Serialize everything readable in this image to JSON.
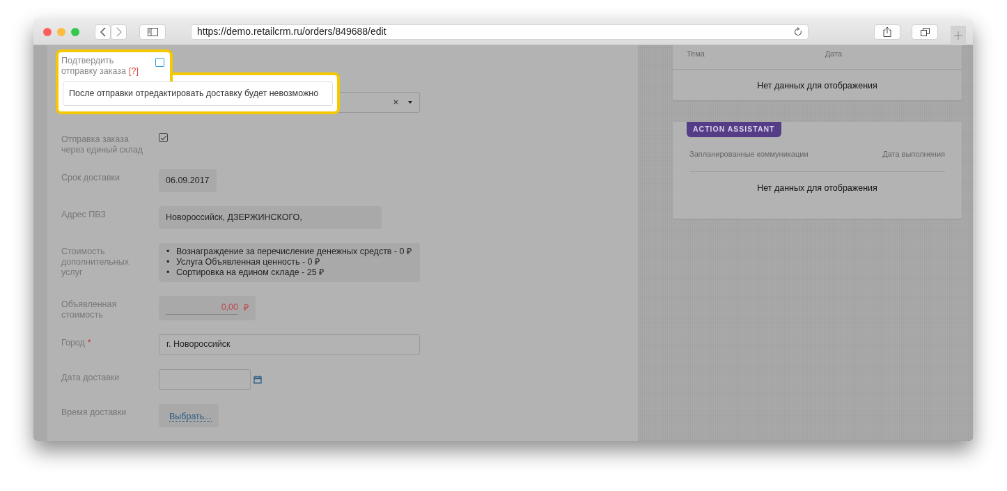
{
  "browser": {
    "url": "https://demo.retailcrm.ru/orders/849688/edit"
  },
  "spotlight": {
    "label": "Подтвердить отправку заказа",
    "help": "[?]",
    "checked": false,
    "tooltip": "После отправки отредактировать доставку будет невозможно"
  },
  "form": [
    {
      "kind": "select",
      "clear": "×"
    },
    {
      "kind": "checkbox",
      "label": "Отправка заказа через единый склад",
      "checked": true
    },
    {
      "kind": "static",
      "label": "Срок доставки",
      "value": "06.09.2017"
    },
    {
      "kind": "static",
      "label": "Адрес ПВЗ",
      "value": "Новороссийск, ДЗЕРЖИНСКОГО,",
      "wide": true
    },
    {
      "kind": "list",
      "label": "Стоимость дополнительных услуг",
      "marker": "•",
      "items": [
        "Вознаграждение за перечисление денежных средств - 0 ₽",
        "Услуга Объявленная ценность - 0 ₽",
        "Сортировка на едином складе - 25 ₽"
      ]
    },
    {
      "kind": "money",
      "label": "Объявленная стоимость",
      "value": "0,00",
      "currency": "₽"
    },
    {
      "kind": "input",
      "label": "Город",
      "required": "*",
      "value": "г. Новороссийск"
    },
    {
      "kind": "date",
      "label": "Дата доставки"
    },
    {
      "kind": "link",
      "label": "Время доставки",
      "value": "Выбрать..."
    }
  ],
  "cards": [
    {
      "columns": [
        "Тема",
        "Дата"
      ],
      "empty": "Нет данных для отображения"
    },
    {
      "badge": "ACTION ASSISTANT",
      "columns": [
        "Запланированные коммуникации",
        "Дата выполнения"
      ],
      "empty": "Нет данных для отображения"
    }
  ]
}
